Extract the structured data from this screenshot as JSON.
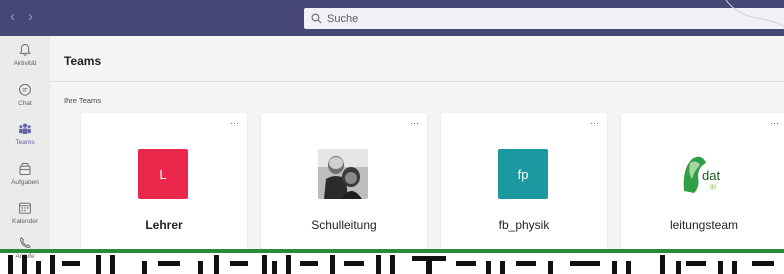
{
  "titlebar": {
    "search_placeholder": "Suche",
    "background": "#464775"
  },
  "rail": {
    "items": [
      {
        "label": "Aktivität",
        "icon": "bell-icon"
      },
      {
        "label": "Chat",
        "icon": "chat-icon"
      },
      {
        "label": "Teams",
        "icon": "teams-icon",
        "active": true
      },
      {
        "label": "Aufgaben",
        "icon": "assignments-icon"
      },
      {
        "label": "Kalender",
        "icon": "calendar-icon"
      },
      {
        "label": "Anrufe",
        "icon": "phone-icon"
      }
    ]
  },
  "main": {
    "title": "Teams",
    "section_label": "Ihre Teams",
    "teams": [
      {
        "name": "Lehrer",
        "avatar_text": "L",
        "avatar_color": "#e8274b",
        "more": "···"
      },
      {
        "name": "Schulleitung",
        "avatar_text": "",
        "avatar_type": "photo",
        "more": "···"
      },
      {
        "name": "fb_physik",
        "avatar_text": "fp",
        "avatar_color": "#1a9aa0",
        "more": "···"
      },
      {
        "name": "leitungsteam",
        "avatar_text": "dat",
        "avatar_sub": "gy",
        "avatar_type": "logo",
        "more": "···"
      }
    ]
  },
  "accent": "#6264a7"
}
